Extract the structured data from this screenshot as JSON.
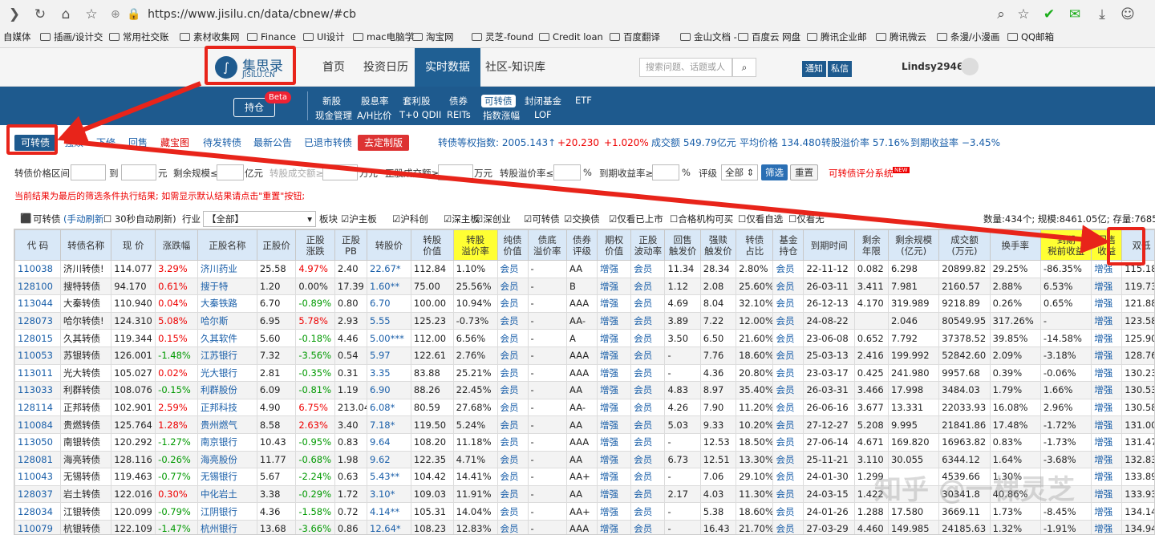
{
  "browser": {
    "url": "https://www.jisilu.cn/data/cbnew/#cb",
    "bookmarks": [
      "自媒体",
      "插画/设计交",
      "常用社交账",
      "素材收集网",
      "Finance",
      "UI设计",
      "mac电脑学",
      "淘宝网",
      "灵芝-found",
      "Credit loan",
      "百度翻译",
      "金山文档 -",
      "百度云 网盘",
      "腾讯企业邮",
      "腾讯微云",
      "条漫/小漫画",
      "QQ邮箱"
    ]
  },
  "site": {
    "logo_text": "集思录",
    "logo_sub": "JISILU.CN",
    "nav": [
      "首页",
      "投资日历",
      "实时数据",
      "社区-知识库"
    ],
    "search_placeholder": "搜索问题、话题或人",
    "notice": "通知",
    "message": "私信",
    "username": "Lindsy2946"
  },
  "subbar": {
    "holdings": "持仓",
    "beta": "Beta",
    "row1": [
      "新股",
      "股息率",
      "套利股",
      "债券",
      "可转债",
      "封闭基金",
      "ETF"
    ],
    "row2": [
      "现金管理",
      "A/H比价",
      "T+0 QDII",
      "REITs",
      "指数涨幅",
      "LOF"
    ]
  },
  "tabs": {
    "items": [
      "可转债",
      "强赎",
      "下修",
      "回售",
      "藏宝图",
      "待发转债",
      "最新公告",
      "已退市转债",
      "去定制版"
    ],
    "index": "转债等权指数: 2005.143↑",
    "change1": "+20.230",
    "change2": "+1.020%",
    "turnover": "成交额 549.79亿元",
    "avg_price": "平均价格 134.480",
    "premium": "转股溢价率 57.16%",
    "ytm": "到期收益率 −3.45%"
  },
  "filter": {
    "price_range": "转债价格区间",
    "to": "到",
    "yuan": "元",
    "remain_le": "剩余规模≤",
    "yiyuan": "亿元",
    "conv_vol": "转股成交额≥",
    "wanyuan": "万元",
    "stock_vol": "正股成交额≥",
    "wanyuan2": "万元",
    "premium_le": "转股溢价率≤",
    "pct": "%",
    "ytm_ge": "到期收益率≥",
    "pct2": "%",
    "rating": "评级",
    "rating_val": "全部",
    "filter_btn": "筛选",
    "reset_btn": "重置",
    "rating_sys": "可转债评分系统",
    "new": "NEW",
    "notice": "当前结果为最后的筛选条件执行结果; 如需显示默认结果请点击\"重置\"按钮;"
  },
  "options": {
    "title": "可转债",
    "manual": "(手动刷新",
    "auto": "30秒自动刷新)",
    "industry": "行业",
    "industry_val": "【全部】",
    "board": "板块",
    "items": [
      "沪主板",
      "沪科创",
      "深主板",
      "深创业",
      "可转债",
      "交换债",
      "仅看已上市",
      "合格机构可买",
      "仅看自选",
      "仅看无"
    ],
    "summary": "数量:434个; 规模:8461.05亿; 存量:7685."
  },
  "table": {
    "headers": [
      "代 码",
      "转债名称",
      "现 价",
      "涨跌幅",
      "正股名称",
      "正股价",
      "正股\n涨跌",
      "正股\nPB",
      "转股价",
      "转股\n价值",
      "转股\n溢价率",
      "纯债\n价值",
      "债底\n溢价率",
      "债券\n评级",
      "期权\n价值",
      "正股\n波动率",
      "回售\n触发价",
      "强赎\n触发价",
      "转债\n占比",
      "基金\n持仓",
      "到期时间",
      "剩余\n年限",
      "剩余规模\n(亿元)",
      "成交额\n(万元)",
      "换手率",
      "到期\n税前收益",
      "回售\n收益",
      "双低"
    ],
    "rows": [
      [
        "110038",
        "济川转债!",
        "114.077",
        "3.29%",
        "济川药业",
        "25.58",
        "4.97%",
        "2.40",
        "22.67*",
        "112.84",
        "1.10%",
        "会员",
        "-",
        "AA",
        "增强",
        "会员",
        "11.34",
        "28.34",
        "2.80%",
        "会员",
        "22-11-12",
        "0.082",
        "6.298",
        "20899.82",
        "29.25%",
        "-86.35%",
        "增强",
        "115.18"
      ],
      [
        "128100",
        "搜特转债",
        "94.170",
        "0.61%",
        "搜于特",
        "1.20",
        "0.00%",
        "17.39",
        "1.60**",
        "75.00",
        "25.56%",
        "会员",
        "-",
        "B",
        "增强",
        "会员",
        "1.12",
        "2.08",
        "25.60%",
        "会员",
        "26-03-11",
        "3.411",
        "7.981",
        "2160.57",
        "2.88%",
        "6.53%",
        "增强",
        "119.73"
      ],
      [
        "113044",
        "大秦转债",
        "110.940",
        "0.04%",
        "大秦铁路",
        "6.70",
        "-0.89%",
        "0.80",
        "6.70",
        "100.00",
        "10.94%",
        "会员",
        "-",
        "AAA",
        "增强",
        "会员",
        "4.69",
        "8.04",
        "32.10%",
        "会员",
        "26-12-13",
        "4.170",
        "319.989",
        "9218.89",
        "0.26%",
        "0.65%",
        "增强",
        "121.88"
      ],
      [
        "128073",
        "哈尔转债!",
        "124.310",
        "5.08%",
        "哈尔斯",
        "6.95",
        "5.78%",
        "2.93",
        "5.55",
        "125.23",
        "-0.73%",
        "会员",
        "-",
        "AA-",
        "增强",
        "会员",
        "3.89",
        "7.22",
        "12.00%",
        "会员",
        "24-08-22",
        "",
        "2.046",
        "80549.95",
        "317.26%",
        "-",
        "增强",
        "123.58"
      ],
      [
        "128015",
        "久其转债",
        "119.344",
        "0.15%",
        "久其软件",
        "5.60",
        "-0.18%",
        "4.46",
        "5.00***",
        "112.00",
        "6.56%",
        "会员",
        "-",
        "A",
        "增强",
        "会员",
        "3.50",
        "6.50",
        "21.60%",
        "会员",
        "23-06-08",
        "0.652",
        "7.792",
        "37378.52",
        "39.85%",
        "-14.58%",
        "增强",
        "125.90"
      ],
      [
        "110053",
        "苏银转债",
        "126.001",
        "-1.48%",
        "江苏银行",
        "7.32",
        "-3.56%",
        "0.54",
        "5.97",
        "122.61",
        "2.76%",
        "会员",
        "-",
        "AAA",
        "增强",
        "会员",
        "-",
        "7.76",
        "18.60%",
        "会员",
        "25-03-13",
        "2.416",
        "199.992",
        "52842.60",
        "2.09%",
        "-3.18%",
        "增强",
        "128.76"
      ],
      [
        "113011",
        "光大转债",
        "105.027",
        "0.02%",
        "光大银行",
        "2.81",
        "-0.35%",
        "0.31",
        "3.35",
        "83.88",
        "25.21%",
        "会员",
        "-",
        "AAA",
        "增强",
        "会员",
        "-",
        "4.36",
        "20.80%",
        "会员",
        "23-03-17",
        "0.425",
        "241.980",
        "9957.68",
        "0.39%",
        "-0.06%",
        "增强",
        "130.23"
      ],
      [
        "113033",
        "利群转债",
        "108.076",
        "-0.15%",
        "利群股份",
        "6.09",
        "-0.81%",
        "1.19",
        "6.90",
        "88.26",
        "22.45%",
        "会员",
        "-",
        "AA",
        "增强",
        "会员",
        "4.83",
        "8.97",
        "35.40%",
        "会员",
        "26-03-31",
        "3.466",
        "17.998",
        "3484.03",
        "1.79%",
        "1.66%",
        "增强",
        "130.53"
      ],
      [
        "128114",
        "正邦转债",
        "102.901",
        "2.59%",
        "正邦科技",
        "4.90",
        "6.75%",
        "213.04",
        "6.08*",
        "80.59",
        "27.68%",
        "会员",
        "-",
        "AA-",
        "增强",
        "会员",
        "4.26",
        "7.90",
        "11.20%",
        "会员",
        "26-06-16",
        "3.677",
        "13.331",
        "22033.93",
        "16.08%",
        "2.96%",
        "增强",
        "130.58"
      ],
      [
        "110084",
        "贵燃转债",
        "125.764",
        "1.28%",
        "贵州燃气",
        "8.58",
        "2.63%",
        "3.40",
        "7.18*",
        "119.50",
        "5.24%",
        "会员",
        "-",
        "AA",
        "增强",
        "会员",
        "5.03",
        "9.33",
        "10.20%",
        "会员",
        "27-12-27",
        "5.208",
        "9.995",
        "21841.86",
        "17.48%",
        "-1.72%",
        "增强",
        "131.00"
      ],
      [
        "113050",
        "南银转债",
        "120.292",
        "-1.27%",
        "南京银行",
        "10.43",
        "-0.95%",
        "0.83",
        "9.64",
        "108.20",
        "11.18%",
        "会员",
        "-",
        "AAA",
        "增强",
        "会员",
        "-",
        "12.53",
        "18.50%",
        "会员",
        "27-06-14",
        "4.671",
        "169.820",
        "16963.82",
        "0.83%",
        "-1.73%",
        "增强",
        "131.47"
      ],
      [
        "128081",
        "海亮转债",
        "128.116",
        "-0.26%",
        "海亮股份",
        "11.77",
        "-0.68%",
        "1.98",
        "9.62",
        "122.35",
        "4.71%",
        "会员",
        "-",
        "AA",
        "增强",
        "会员",
        "6.73",
        "12.51",
        "13.30%",
        "会员",
        "25-11-21",
        "3.110",
        "30.055",
        "6344.12",
        "1.64%",
        "-3.68%",
        "增强",
        "132.83"
      ],
      [
        "110043",
        "无锡转债",
        "119.463",
        "-0.77%",
        "无锡银行",
        "5.67",
        "-2.24%",
        "0.63",
        "5.43**",
        "104.42",
        "14.41%",
        "会员",
        "-",
        "AA+",
        "增强",
        "会员",
        "-",
        "7.06",
        "29.10%",
        "会员",
        "24-01-30",
        "1.299",
        "",
        "4539.66",
        "1.30%",
        "",
        "增强",
        "133.89"
      ],
      [
        "128037",
        "岩土转债",
        "122.016",
        "0.30%",
        "中化岩土",
        "3.38",
        "-0.29%",
        "1.72",
        "3.10*",
        "109.03",
        "11.91%",
        "会员",
        "-",
        "AA",
        "增强",
        "会员",
        "2.17",
        "4.03",
        "11.30%",
        "会员",
        "24-03-15",
        "1.422",
        "",
        "30341.8",
        "40.86%",
        "",
        "增强",
        "133.93"
      ],
      [
        "128034",
        "江银转债",
        "120.099",
        "-0.79%",
        "江阴银行",
        "4.36",
        "-1.58%",
        "0.72",
        "4.14**",
        "105.31",
        "14.04%",
        "会员",
        "-",
        "AA+",
        "增强",
        "会员",
        "-",
        "5.38",
        "18.60%",
        "会员",
        "24-01-26",
        "1.288",
        "17.580",
        "3669.11",
        "1.73%",
        "-8.45%",
        "增强",
        "134.14"
      ],
      [
        "110079",
        "杭银转债",
        "122.109",
        "-1.47%",
        "杭州银行",
        "13.68",
        "-3.66%",
        "0.86",
        "12.64*",
        "108.23",
        "12.83%",
        "会员",
        "-",
        "AAA",
        "增强",
        "会员",
        "-",
        "16.43",
        "21.70%",
        "会员",
        "27-03-29",
        "4.460",
        "149.985",
        "24185.63",
        "1.32%",
        "-1.91%",
        "增强",
        "134.94"
      ]
    ]
  },
  "watermark": "知乎 @一棵灵芝",
  "colors": {
    "brand": "#1e5a8e",
    "highlight": "#ffff33",
    "arrow": "#e8241a"
  }
}
